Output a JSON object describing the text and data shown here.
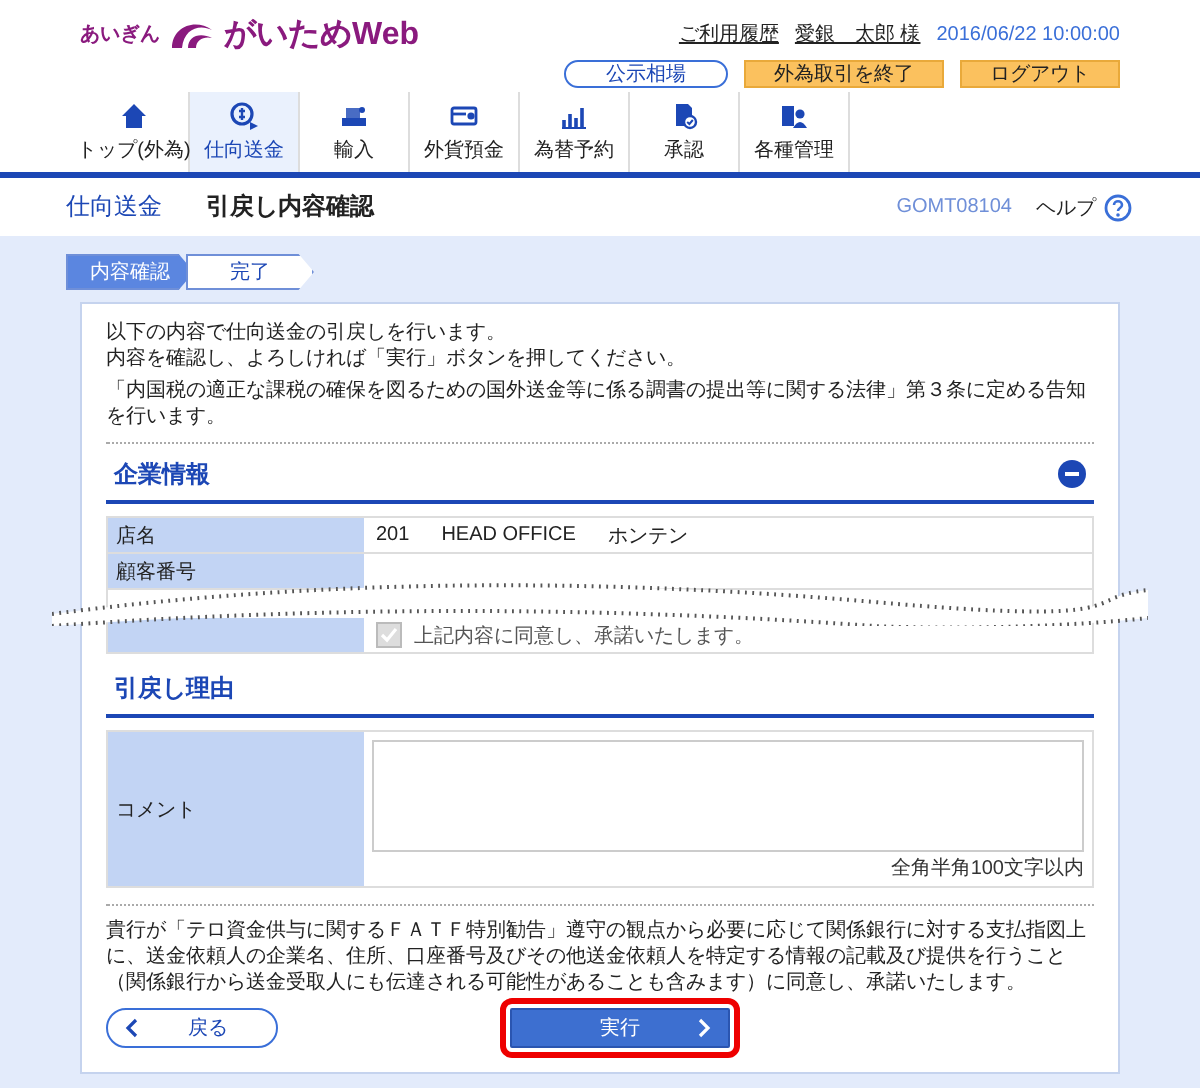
{
  "header": {
    "logo": {
      "prefix": "あいぎん",
      "name": "がいためWeb"
    },
    "links": [
      "ご利用履歴",
      "愛銀　太郎 様"
    ],
    "datetime": "2016/06/22 10:00:00",
    "buttons": [
      {
        "label": "公示相場",
        "kind": "outline"
      },
      {
        "label": "外為取引を終了",
        "kind": "accent"
      },
      {
        "label": "ログアウト",
        "kind": "accent"
      }
    ]
  },
  "nav": [
    {
      "label": "トップ(外為)",
      "selected": false
    },
    {
      "label": "仕向送金",
      "selected": true
    },
    {
      "label": "輸入",
      "selected": false
    },
    {
      "label": "外貨預金",
      "selected": false
    },
    {
      "label": "為替予約",
      "selected": false
    },
    {
      "label": "承認",
      "selected": false
    },
    {
      "label": "各種管理",
      "selected": false
    }
  ],
  "page_header": {
    "section": "仕向送金",
    "title": "引戻し内容確認",
    "screen_id": "GOMT08104",
    "help": "ヘルプ"
  },
  "steps": [
    {
      "label": "内容確認",
      "selected": true
    },
    {
      "label": "完了",
      "selected": false
    }
  ],
  "intro": [
    "以下の内容で仕向送金の引戻しを行います。",
    "内容を確認し、よろしければ「実行」ボタンを押してください。"
  ],
  "notice": "「内国税の適正な課税の確保を図るための国外送金等に係る調書の提出等に関する法律」第３条に定める告知を行います。",
  "company": {
    "title": "企業情報",
    "expanded": true,
    "rows": [
      {
        "kind": "text",
        "label": "店名",
        "values": [
          "201",
          "HEAD OFFICE",
          "ホンテン"
        ]
      },
      {
        "kind": "text",
        "label": "顧客番号",
        "values": []
      },
      {
        "kind": "break"
      },
      {
        "kind": "checkbox",
        "checked": true,
        "disabled": true,
        "text": "上記内容に同意し、承諾いたします。"
      }
    ]
  },
  "reason": {
    "title": "引戻し理由",
    "label": "コメント",
    "hint": "全角半角100文字以内"
  },
  "consent": "貴行が「テロ資金供与に関するＦＡＴＦ特別勧告」遵守の観点から必要に応じて関係銀行に対する支払指図上に、送金依頼人の企業名、住所、口座番号及びその他送金依頼人を特定する情報の記載及び提供を行うこと（関係銀行から送金受取人にも伝達される可能性があることも含みます）に同意し、承諾いたします。",
  "actions": [
    {
      "label": "戻る",
      "kind": "back",
      "highlighted": false
    },
    {
      "label": "実行",
      "kind": "submit",
      "highlighted": true
    }
  ]
}
